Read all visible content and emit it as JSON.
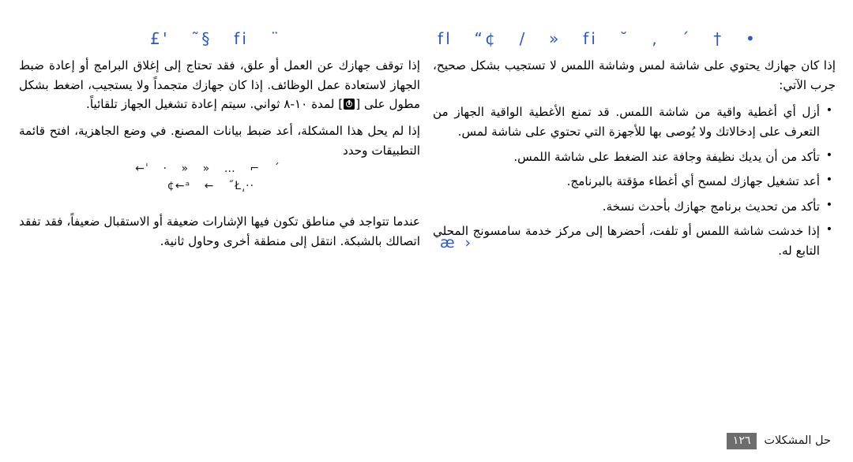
{
  "document": {
    "language": "ar",
    "direction": "rtl",
    "accent_color": "#2558d6",
    "text_color": "#000000",
    "page_number_badge_color": "#6d6d6d",
    "background": "#ffffff"
  },
  "headings": {
    "right_column": "fl      “¢ / »  fi  ˘      ,          ´      †          •",
    "left_column": "£'        ˜§  fi  ¨"
  },
  "right_column": {
    "intro": "إذا كان جهازك يحتوي على شاشة لمس وشاشة اللمس لا تستجيب بشكل صحيح، جرب الآتي:",
    "bullets": [
      "أزل أي أغطية واقية من شاشة اللمس. قد تمنع الأغطية الواقية الجهاز من التعرف على إدخالاتك ولا يُوصى بها للأجهزة التي تحتوي على شاشة لمس.",
      "تأكد من أن يديك نظيفة وجافة عند الضغط على شاشة اللمس.",
      "أعد تشغيل جهازك لمسح أي أغطاء مؤقتة بالبرنامج.",
      "تأكد من تحديث برنامج جهازك بأحدث نسخة.",
      "إذا خدشت شاشة اللمس أو تلفت، أحضرها إلى مركز خدمة سامسونج المحلي التابع له."
    ],
    "stray_glyph": "æ ›"
  },
  "left_column": {
    "para1_part1": "إذا توقف جهازك عن العمل أو علق، فقد تحتاج إلى إغلاق البرامج أو إعادة ضبط الجهاز لاستعادة عمل الوظائف. إذا كان جهازك متجمداً ولا يستجيب، اضغط بشكل مطول على [",
    "para1_part2": "] لمدة ١٠-٨ ثواني. سيتم إعادة تشغيل الجهاز تلقائياً.",
    "power_key_icon": "power-key-icon",
    "para2": "إذا لم يحل هذا المشكلة، أعد ضبط بيانات المصنع. في وضع الجاهزية، افتح قائمة التطبيقات وحدد",
    "crumb_line1": "←ˈ   · »   »  …  ⌐   ´",
    "crumb_line2": "¢←ᵃ            ←   ˝Ł͵··",
    "para3": "عندما تتواجد في مناطق تكون فيها الإشارات ضعيفة أو الاستقبال ضعيفاً، فقد تفقد اتصالك بالشبكة. انتقل إلى منطقة أخرى وحاول ثانية."
  },
  "footer": {
    "section_label": "حل المشكلات",
    "page_number": "١٢٦"
  }
}
